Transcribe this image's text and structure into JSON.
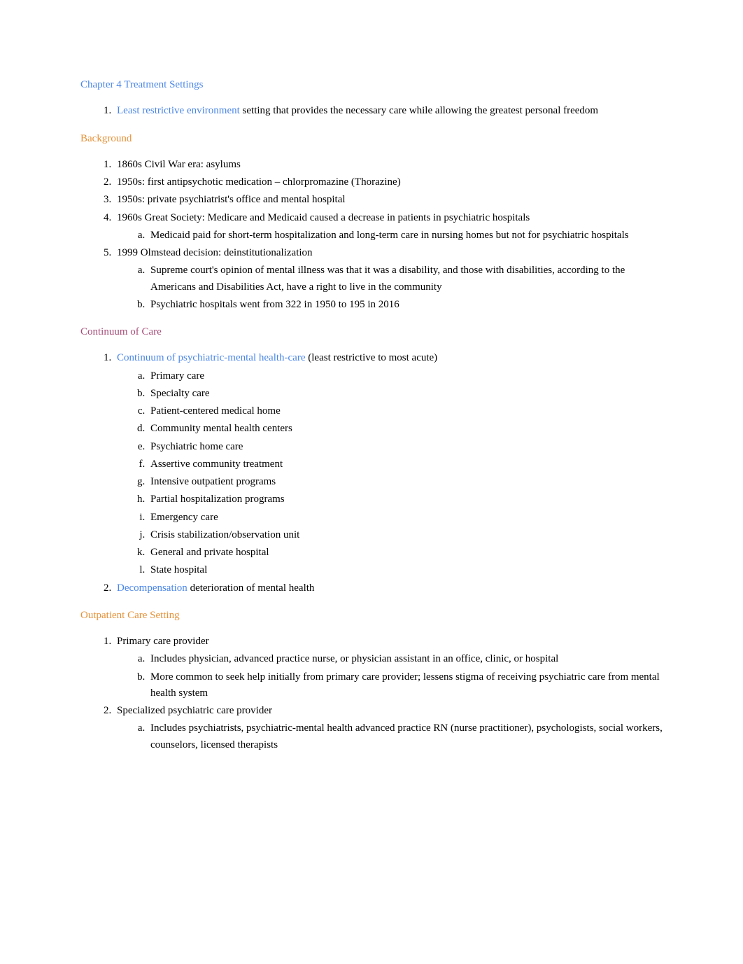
{
  "chapter": {
    "title": "Chapter 4 Treatment Settings"
  },
  "intro": {
    "term": "Least restrictive environment",
    "def": " setting that provides the necessary care while allowing the greatest personal freedom"
  },
  "background": {
    "heading": "Background",
    "items": [
      {
        "text": "1860s Civil War era: asylums"
      },
      {
        "text": "1950s: first antipsychotic medication – chlorpromazine (Thorazine)"
      },
      {
        "text": "1950s: private psychiatrist's office and mental hospital"
      },
      {
        "text": "1960s Great Society: Medicare and Medicaid caused a decrease in patients in psychiatric hospitals",
        "sub": [
          "Medicaid paid for short-term hospitalization and long-term care in nursing homes but not for psychiatric hospitals"
        ]
      },
      {
        "text": "1999 Olmstead decision: deinstitutionalization",
        "sub": [
          "Supreme court's opinion of mental illness was that it was a disability, and those with disabilities, according to the Americans and Disabilities Act, have a right to live in the community",
          "Psychiatric hospitals went from 322 in 1950 to 195 in 2016"
        ]
      }
    ]
  },
  "continuum": {
    "heading": "Continuum of Care",
    "item1": {
      "term": "Continuum of psychiatric-mental health-care",
      "def": " (least restrictive to most acute)",
      "sub": [
        "Primary care",
        "Specialty care",
        "Patient-centered medical home",
        "Community mental health centers",
        "Psychiatric home care",
        "Assertive community treatment",
        "Intensive outpatient programs",
        "Partial hospitalization programs",
        "Emergency care",
        "Crisis stabilization/observation unit",
        "General and private hospital",
        "State hospital"
      ]
    },
    "item2": {
      "term": "Decompensation",
      "def": " deterioration of mental health"
    }
  },
  "outpatient": {
    "heading": "Outpatient Care Setting",
    "items": [
      {
        "text": "Primary care provider",
        "sub": [
          "Includes physician, advanced practice nurse, or physician assistant in an office, clinic, or hospital",
          "More common to seek help initially from primary care provider; lessens stigma of receiving psychiatric care from mental health system"
        ]
      },
      {
        "text": "Specialized psychiatric care provider",
        "sub": [
          "Includes psychiatrists, psychiatric-mental health advanced practice RN (nurse practitioner), psychologists, social workers, counselors, licensed therapists"
        ]
      }
    ]
  }
}
